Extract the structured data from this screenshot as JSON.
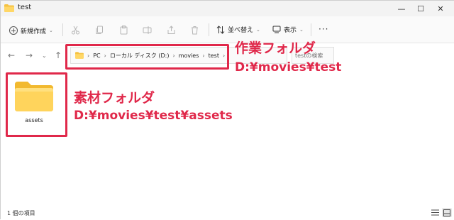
{
  "window": {
    "title": "test",
    "controls": {
      "minimize": "—",
      "maximize": "☐",
      "close": "✕"
    }
  },
  "commandbar": {
    "new_label": "新規作成",
    "sort_label": "並べ替え",
    "view_label": "表示",
    "more_label": "···",
    "icons": [
      "cut-icon",
      "copy-icon",
      "paste-icon",
      "rename-icon",
      "share-icon",
      "delete-icon"
    ]
  },
  "address": {
    "crumbs": [
      "PC",
      "ローカル ディスク (D:)",
      "movies",
      "test"
    ],
    "search_placeholder": "testの検索"
  },
  "content": {
    "items": [
      {
        "label": "assets"
      }
    ]
  },
  "annotations": {
    "work_folder_title": "作業フォルダ",
    "work_folder_path": "D:¥movies¥test",
    "material_folder_title": "素材フォルダ",
    "material_folder_path": "D:¥movies¥test¥assets",
    "color": "#e0284a"
  },
  "status": {
    "item_count": "1 個の項目"
  }
}
